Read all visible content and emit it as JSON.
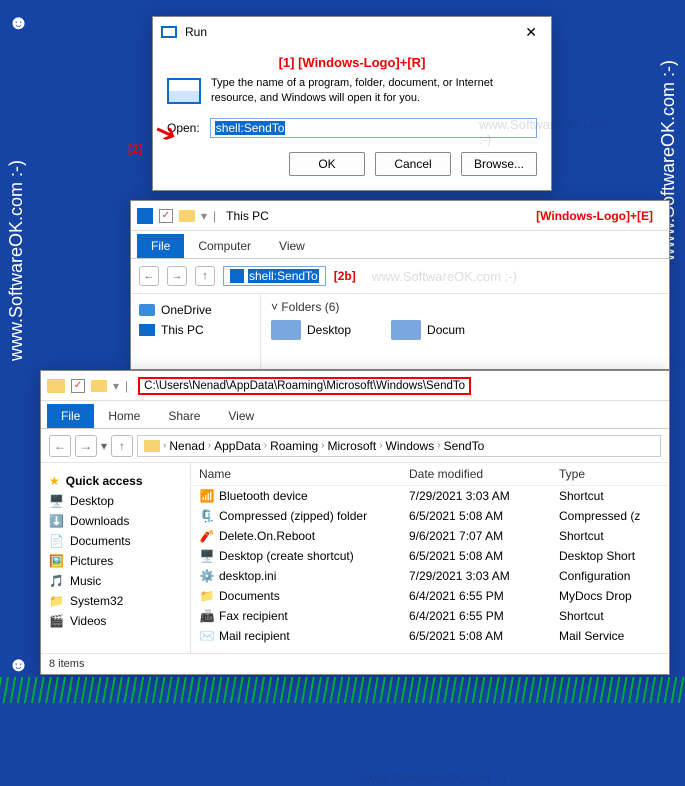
{
  "branding": {
    "side_text": "www.SoftwareOK.com  :-)",
    "watermark": "www.SoftwareOK.com  :-)"
  },
  "run_dialog": {
    "title": "Run",
    "callout_top": "[1]   [Windows-Logo]+[R]",
    "description": "Type the name of a program, folder, document, or Internet resource, and Windows will open it for you.",
    "open_label": "Open:",
    "input_value": "shell:SendTo",
    "buttons": {
      "ok": "OK",
      "cancel": "Cancel",
      "browse": "Browse..."
    },
    "callout_left": "[2]"
  },
  "explorer1": {
    "title": "This PC",
    "hotkey": "[Windows-Logo]+[E]",
    "tabs": {
      "file": "File",
      "computer": "Computer",
      "view": "View"
    },
    "address_value": "shell:SendTo",
    "callout": "[2b]",
    "sidebar": [
      "OneDrive",
      "This PC"
    ],
    "folders_header": "Folders (6)",
    "folders": [
      "Desktop",
      "Docum"
    ]
  },
  "explorer2": {
    "title_path": "C:\\Users\\Nenad\\AppData\\Roaming\\Microsoft\\Windows\\SendTo",
    "tabs": {
      "file": "File",
      "home": "Home",
      "share": "Share",
      "view": "View"
    },
    "breadcrumbs": [
      "Nenad",
      "AppData",
      "Roaming",
      "Microsoft",
      "Windows",
      "SendTo"
    ],
    "sidebar_header": "Quick access",
    "sidebar": [
      "Desktop",
      "Downloads",
      "Documents",
      "Pictures",
      "Music",
      "System32",
      "Videos"
    ],
    "columns": {
      "name": "Name",
      "date": "Date modified",
      "type": "Type"
    },
    "files": [
      {
        "icon": "📶",
        "name": "Bluetooth device",
        "date": "7/29/2021 3:03 AM",
        "type": "Shortcut"
      },
      {
        "icon": "🗜️",
        "name": "Compressed (zipped) folder",
        "date": "6/5/2021 5:08 AM",
        "type": "Compressed (z"
      },
      {
        "icon": "🧨",
        "name": "Delete.On.Reboot",
        "date": "9/6/2021 7:07 AM",
        "type": "Shortcut"
      },
      {
        "icon": "🖥️",
        "name": "Desktop (create shortcut)",
        "date": "6/5/2021 5:08 AM",
        "type": "Desktop Short"
      },
      {
        "icon": "⚙️",
        "name": "desktop.ini",
        "date": "7/29/2021 3:03 AM",
        "type": "Configuration"
      },
      {
        "icon": "📁",
        "name": "Documents",
        "date": "6/4/2021 6:55 PM",
        "type": "MyDocs Drop"
      },
      {
        "icon": "📠",
        "name": "Fax recipient",
        "date": "6/4/2021 6:55 PM",
        "type": "Shortcut"
      },
      {
        "icon": "✉️",
        "name": "Mail recipient",
        "date": "6/5/2021 5:08 AM",
        "type": "Mail Service"
      }
    ],
    "status": "8 items"
  }
}
